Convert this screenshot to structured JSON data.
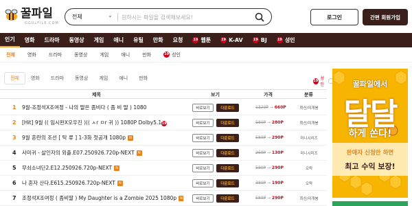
{
  "brand": {
    "logo_text": "꿀파일",
    "logo_sub": "GGULFILE.COM"
  },
  "search": {
    "category": "전체",
    "placeholder": "원하시는 파일을 검색해보세요!"
  },
  "auth": {
    "login_label": "로그인",
    "join_label": "간편 회원가입"
  },
  "nav": {
    "items": [
      "인기",
      "영화",
      "드라마",
      "동영상",
      "게임",
      "애니",
      "유틸",
      "만화",
      "요청"
    ],
    "adult_items": [
      "웹툰",
      "K-AV",
      "BJ",
      "성인"
    ]
  },
  "subnav": {
    "items": [
      "전체",
      "영화",
      "드라마",
      "동영상",
      "게임",
      "애니",
      "만화"
    ],
    "adult_item": "성인"
  },
  "tabs": {
    "items": [
      "전체",
      "영화",
      "드라마",
      "동영상",
      "게임",
      "애니",
      "만화"
    ],
    "adult_toggle_label": "성인"
  },
  "table": {
    "headers": {
      "title": "제목",
      "view": "보기",
      "price": "가격",
      "category": "분류"
    },
    "view_label": "바로보기",
    "download_label": "다운로드",
    "rows": [
      {
        "num": "1",
        "title": "9월-조정석X조여정 - 나의 딸은 좀비다 ( 좀 비 딸 ) 1080",
        "badge": "",
        "old": "1320P",
        "new": "660P",
        "cls": "최신/미개봉"
      },
      {
        "num": "2",
        "title": "[Hit] 9월 (( 임시완X오우진 )(( ㅅr ㅁr 귀 )) 1080P Dolby5.1",
        "badge": "19",
        "old": "580P",
        "new": "280P",
        "cls": "최신/미개봉"
      },
      {
        "num": "3",
        "title": "9월 혼란의 조선 [ 탁 류 ] 1-3화 첫공개 1080p",
        "badge": "N",
        "old": "580P",
        "new": "290P",
        "cls": "미니시리즈"
      },
      {
        "num": "4",
        "title": "사미귀 - 살인자의 외출.E07.250926.720p-NEXT",
        "badge": "N",
        "old": "260P",
        "new": "130P",
        "cls": "미니시리즈"
      },
      {
        "num": "5",
        "title": "무쇠소녀단2.E12.250926.720p-NEXT",
        "badge": "N",
        "old": "580P",
        "new": "290P",
        "cls": "오락"
      },
      {
        "num": "6",
        "title": "나 혼자 산다.E615.250926.720p-NEXT",
        "badge": "N",
        "old": "380P",
        "new": "190P",
        "cls": "오락"
      },
      {
        "num": "7",
        "title": "조정석X조여정 ( 좀비딸 ) My Daughter is a Zombie 2025 1080p",
        "badge": "N",
        "old": "580P",
        "new": "290P",
        "cls": "최신/미개봉"
      }
    ]
  },
  "ad": {
    "line1": "꿀파일에서",
    "big": "달달",
    "line3": "하게 쏜다!",
    "line4": "판매자 신청만 하면",
    "line5": "최고 수익 보장!"
  },
  "colors": {
    "brand_dark": "#3a1f1a",
    "accent": "#e8821b",
    "price_red": "#d0021b",
    "ad_yellow": "#f7b500"
  }
}
